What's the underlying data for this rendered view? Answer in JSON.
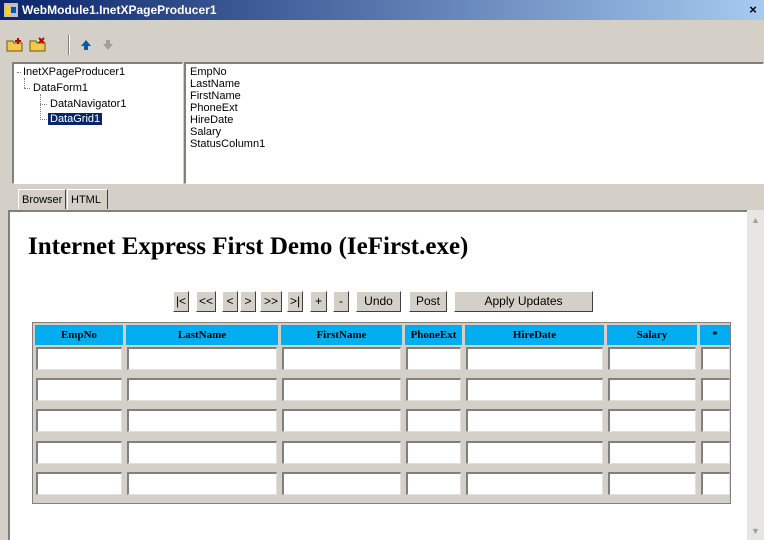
{
  "window": {
    "title": "WebModule1.InetXPageProducer1",
    "close_glyph": "×"
  },
  "toolbar": {
    "buttons": [
      "new-item-icon",
      "delete-item-icon",
      "move-up-icon",
      "move-down-icon"
    ]
  },
  "tree": {
    "items": [
      {
        "label": "InetXPageProducer1",
        "level": 0
      },
      {
        "label": "DataForm1",
        "level": 1
      },
      {
        "label": "DataNavigator1",
        "level": 2
      },
      {
        "label": "DataGrid1",
        "level": 2,
        "selected": true
      }
    ]
  },
  "fields": [
    "EmpNo",
    "LastName",
    "FirstName",
    "PhoneExt",
    "HireDate",
    "Salary",
    "StatusColumn1"
  ],
  "tabs": [
    {
      "label": "Browser",
      "active": true
    },
    {
      "label": "HTML",
      "active": false
    }
  ],
  "page": {
    "title": "Internet Express First Demo (IeFirst.exe)",
    "nav_buttons": [
      "|<",
      "<<",
      "<",
      ">",
      ">>",
      ">|",
      "+",
      "-",
      "Undo",
      "Post",
      "Apply Updates"
    ]
  },
  "grid": {
    "columns": [
      "EmpNo",
      "LastName",
      "FirstName",
      "PhoneExt",
      "HireDate",
      "Salary",
      "*"
    ],
    "header_color": "#00adef",
    "row_count": 5
  },
  "colors": {
    "face": "#d4d0c8",
    "title_start": "#0a246a",
    "title_end": "#a6caf0",
    "selection": "#0a246a"
  }
}
